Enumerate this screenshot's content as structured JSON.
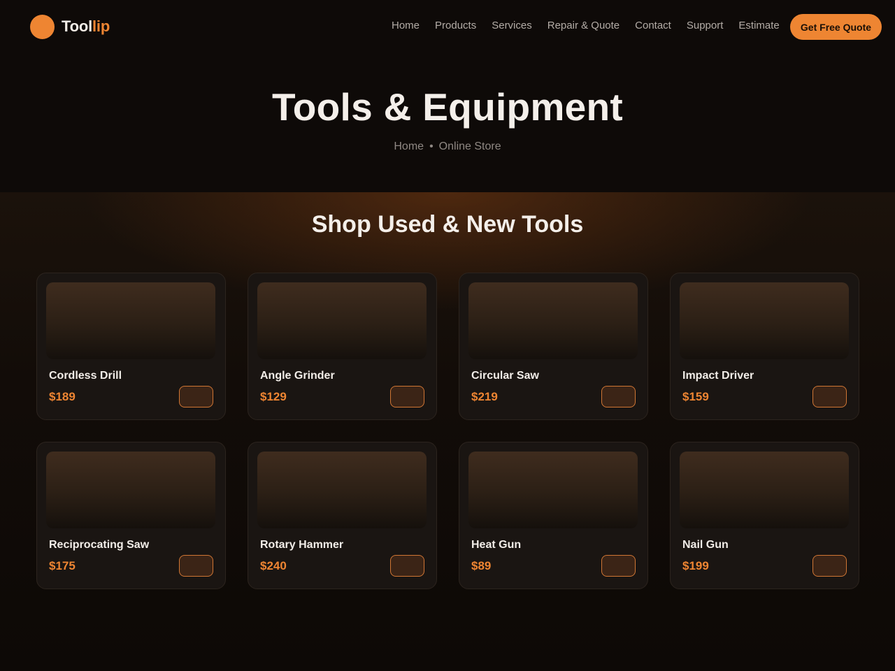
{
  "brand": {
    "name_part1": "Tool",
    "name_part2": "lip",
    "accent": "#ee8532"
  },
  "nav": {
    "items": [
      "Home",
      "Products",
      "Services",
      "Repair & Quote",
      "Contact",
      "Support",
      "Estimate"
    ],
    "cta_label": "Get Free Quote"
  },
  "hero": {
    "title": "Tools & Equipment",
    "breadcrumb": [
      "Home",
      "Online Store"
    ]
  },
  "shop": {
    "title": "Shop Used & New Tools",
    "products": [
      {
        "name": "Cordless Drill",
        "price": "$189"
      },
      {
        "name": "Angle Grinder",
        "price": "$129"
      },
      {
        "name": "Circular Saw",
        "price": "$219"
      },
      {
        "name": "Impact Driver",
        "price": "$159"
      },
      {
        "name": "Reciprocating Saw",
        "price": "$175"
      },
      {
        "name": "Rotary Hammer",
        "price": "$240"
      },
      {
        "name": "Heat Gun",
        "price": "$89"
      },
      {
        "name": "Nail Gun",
        "price": "$199"
      }
    ]
  }
}
